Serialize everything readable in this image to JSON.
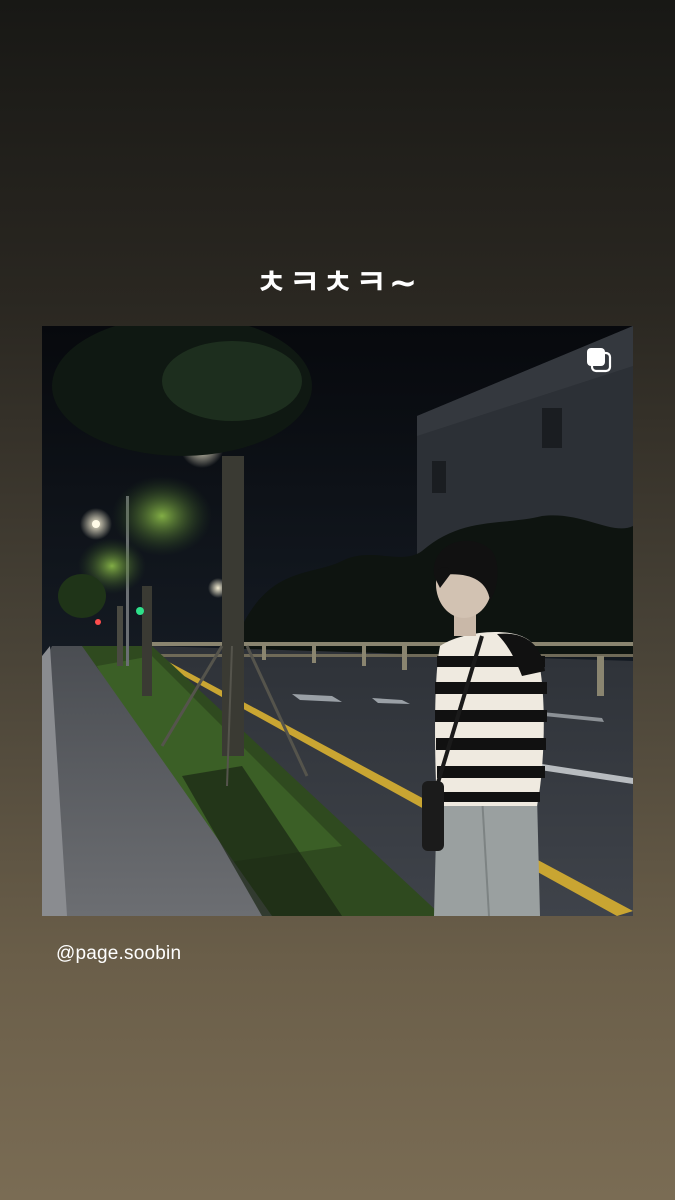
{
  "story": {
    "caption": "ㅊㅋㅊㅋ~",
    "mention": "@page.soobin"
  },
  "post": {
    "icon": "carousel-icon",
    "photo_subject": "person-in-striped-sweater"
  },
  "colors": {
    "background_top": "#181815",
    "background_bottom": "#7a6c54",
    "text": "#ffffff"
  }
}
